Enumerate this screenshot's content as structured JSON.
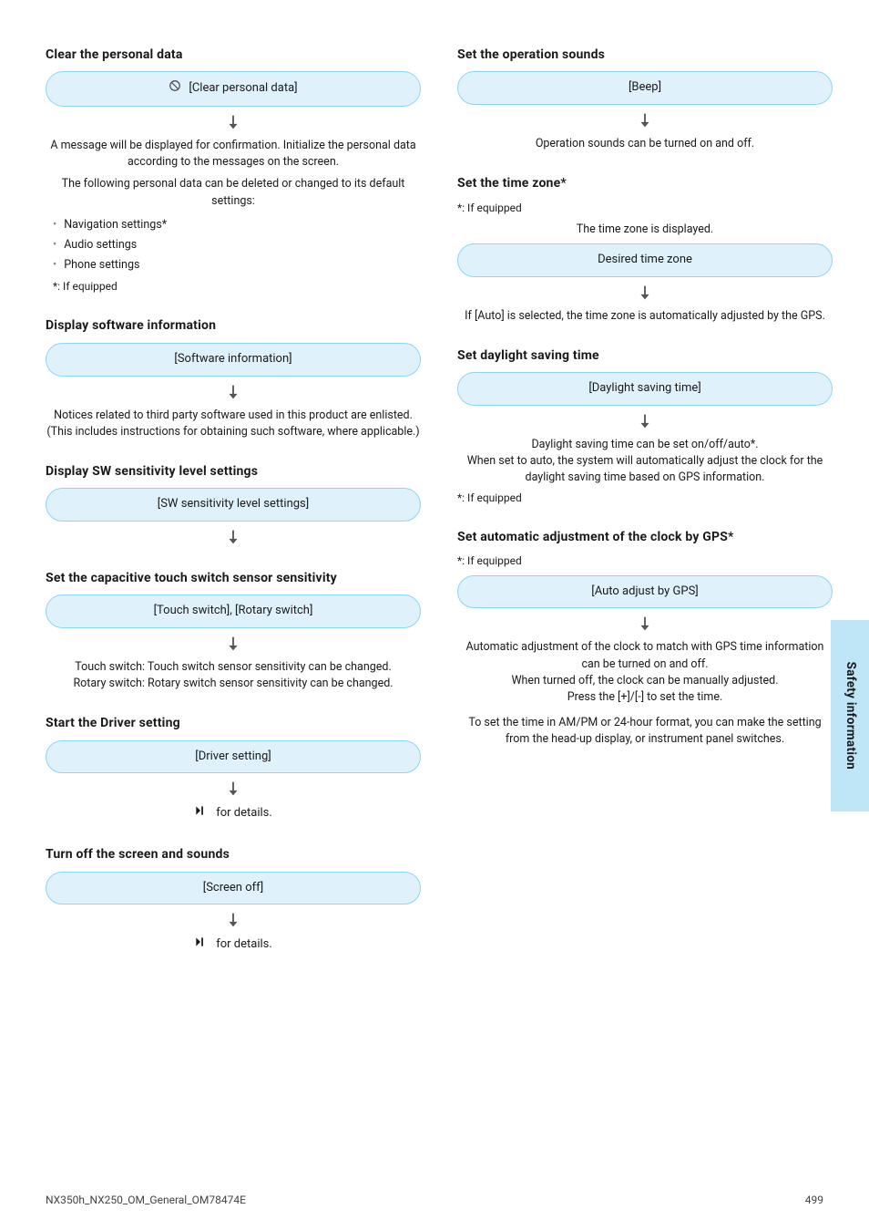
{
  "sidebar": {
    "label": "Safety information"
  },
  "footer": {
    "left": "NX350h_NX250_OM_General_OM78474E",
    "right": "499"
  },
  "left_column": [
    {
      "title": "Clear the personal data",
      "pill": {
        "icon": "ban-icon",
        "text": "[Clear personal data]"
      },
      "desc": [
        "A message will be displayed for confirmation. Initialize the personal data according to the messages on the screen.",
        "The following personal data can be deleted or changed to its default settings:"
      ],
      "list": [
        "Navigation settings*",
        "Audio settings",
        "Phone settings"
      ],
      "footnote": "*: If equipped"
    },
    {
      "title": "Display software information",
      "pill": {
        "text": "[Software information]"
      },
      "desc": [
        "Notices related to third party software used in this product are enlisted. (This includes instructions for obtaining such software, where applicable.)"
      ]
    },
    {
      "title": "Display SW sensitivity level settings",
      "pill": {
        "text": "[SW sensitivity level settings]"
      },
      "desc": []
    },
    {
      "title": "Set the capacitive touch switch sensor sensitivity",
      "pill": {
        "text": "[Touch switch], [Rotary switch]"
      },
      "desc": [
        "Touch switch: Touch switch sensor sensitivity can be changed.",
        "Rotary switch: Rotary switch sensor sensitivity can be changed."
      ]
    },
    {
      "title": "Start the Driver setting",
      "pill": {
        "text": "[Driver setting]"
      },
      "skip": "for details."
    },
    {
      "title": "Turn off the screen and sounds",
      "pill": {
        "text": "[Screen off]"
      },
      "skip": "for details."
    }
  ],
  "right_column": [
    {
      "title": "Set the operation sounds",
      "pill": {
        "text": "[Beep]"
      },
      "desc": [
        "Operation sounds can be turned on and off."
      ]
    },
    {
      "title": "Set the time zone*",
      "footnote_top": "*: If equipped",
      "intro": "The time zone is displayed.",
      "pill": {
        "text": "Desired time zone"
      },
      "desc": [
        "If [Auto] is selected, the time zone is automatically adjusted by the GPS."
      ]
    },
    {
      "title": "Set daylight saving time",
      "pill": {
        "text": "[Daylight saving time]"
      },
      "desc": [
        "Daylight saving time can be set on/off/auto*.",
        "When set to auto, the system will automatically adjust the clock for the daylight saving time based on GPS information."
      ],
      "footnote": "*: If equipped"
    },
    {
      "title": "Set automatic adjustment of the clock by GPS*",
      "footnote_top": "*: If equipped",
      "pill": {
        "text": "[Auto adjust by GPS]"
      },
      "desc": [
        "Automatic adjustment of the clock to match with GPS time information can be turned on and off.",
        "When turned off, the clock can be manually adjusted.",
        "Press the [+]/[-] to set the time.",
        "To set the time in AM/PM or 24-hour format, you can make the setting from the head-up display, or instrument panel switches."
      ]
    }
  ]
}
